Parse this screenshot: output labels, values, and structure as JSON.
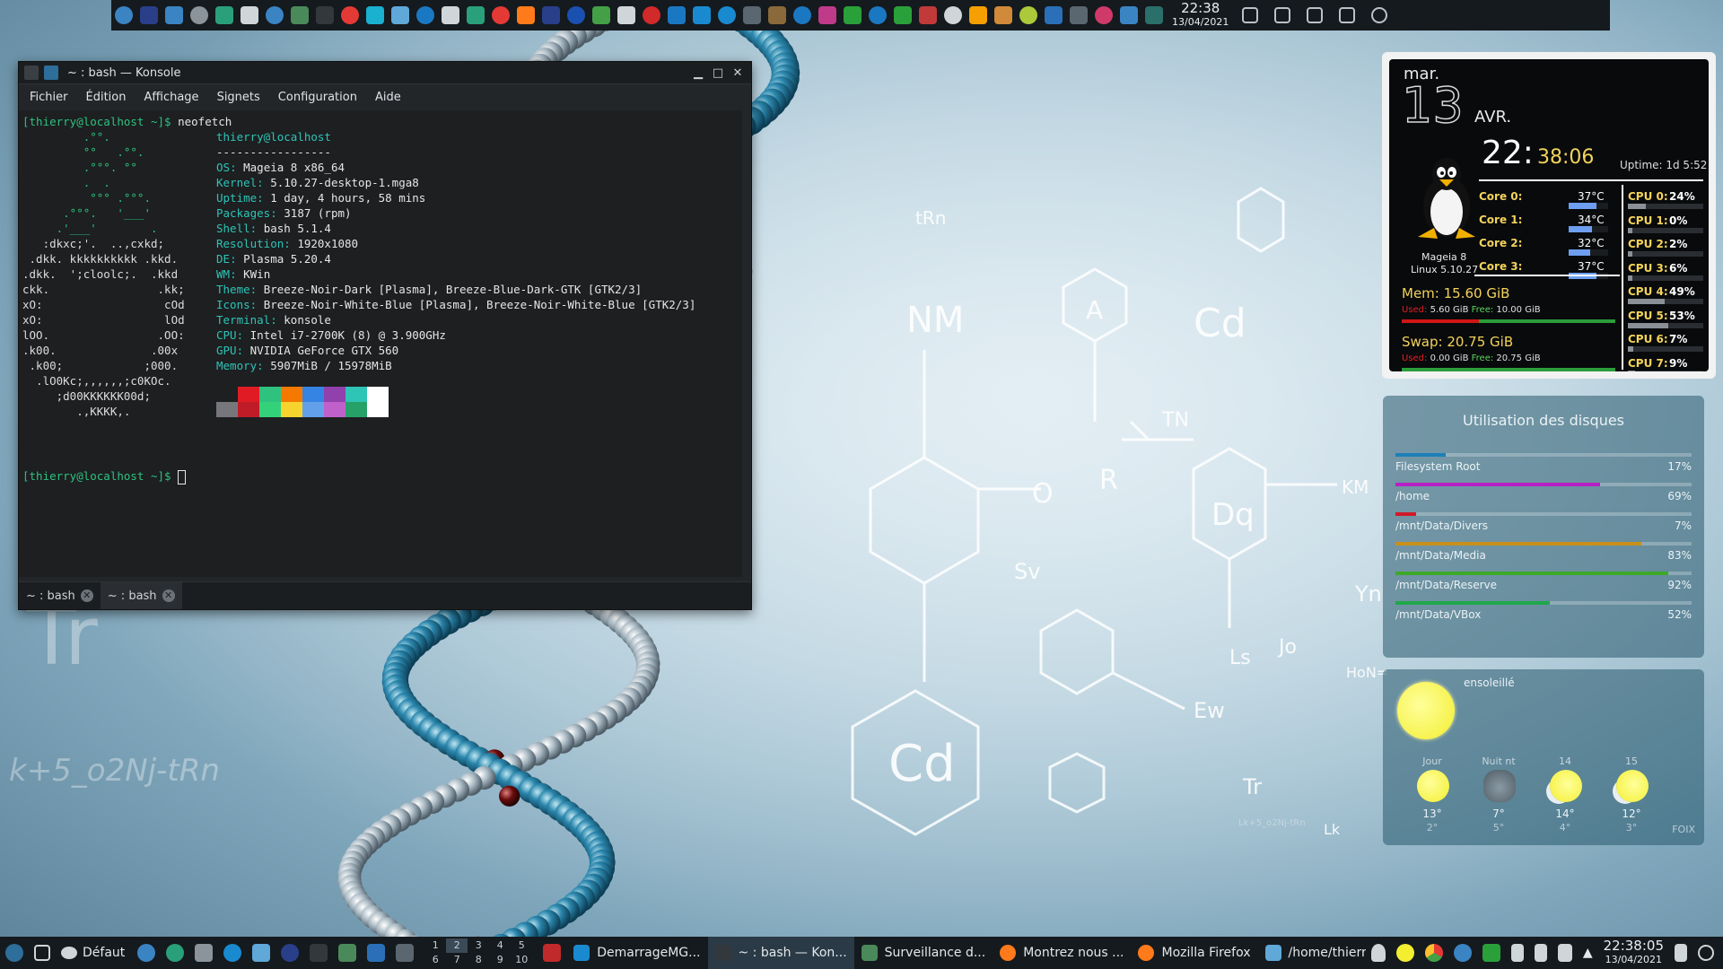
{
  "top_panel": {
    "clock_time": "22:38",
    "clock_date": "13/04/2021"
  },
  "konsole": {
    "title": "~ : bash — Konsole",
    "menu": [
      "Fichier",
      "Édition",
      "Affichage",
      "Signets",
      "Configuration",
      "Aide"
    ],
    "prompt1": "[thierry@localhost ~]$ ",
    "command": "neofetch",
    "prompt2": "[thierry@localhost ~]$ ",
    "user_host": "thierry@localhost",
    "separator": "-----------------",
    "ascii": [
      "         .°°.",
      "         °°   .°°.",
      "         .°°°. °°",
      "         .  .",
      "          °°° .°°°.",
      "      .°°°.   '___'",
      "     .'___'        .",
      "   :dkxc;'.  ..,cxkd;",
      " .dkk. kkkkkkkkkk .kkd.",
      ".dkk.  ';cloolc;.  .kkd",
      "ckk.                .kk;",
      "xO:                  cOd",
      "xO:                  lOd",
      "lOO.                .OO:",
      ".k00.              .00x",
      " .k00;            ;000.",
      "  .lO0Kc;,,,,,,;c0KOc.",
      "     ;d00KKKKKK00d;",
      "        .,KKKK,."
    ],
    "info": [
      {
        "key": "OS",
        "value": "Mageia 8 x86_64"
      },
      {
        "key": "Kernel",
        "value": "5.10.27-desktop-1.mga8"
      },
      {
        "key": "Uptime",
        "value": "1 day, 4 hours, 58 mins"
      },
      {
        "key": "Packages",
        "value": "3187 (rpm)"
      },
      {
        "key": "Shell",
        "value": "bash 5.1.4"
      },
      {
        "key": "Resolution",
        "value": "1920x1080"
      },
      {
        "key": "DE",
        "value": "Plasma 5.20.4"
      },
      {
        "key": "WM",
        "value": "KWin"
      },
      {
        "key": "Theme",
        "value": "Breeze-Noir-Dark [Plasma], Breeze-Blue-Dark-GTK [GTK2/3]"
      },
      {
        "key": "Icons",
        "value": "Breeze-Noir-White-Blue [Plasma], Breeze-Noir-White-Blue [GTK2/3]"
      },
      {
        "key": "Terminal",
        "value": "konsole"
      },
      {
        "key": "CPU",
        "value": "Intel i7-2700K (8) @ 3.900GHz"
      },
      {
        "key": "GPU",
        "value": "NVIDIA GeForce GTX 560"
      },
      {
        "key": "Memory",
        "value": "5907MiB / 15978MiB"
      }
    ],
    "palette_top": [
      "#1d1f21",
      "#e01b24",
      "#2ec27e",
      "#f57900",
      "#3584e4",
      "#9141ac",
      "#2ec4b6",
      "#ffffff"
    ],
    "palette_bottom": [
      "#77767b",
      "#c01c28",
      "#33d17a",
      "#f6d32d",
      "#62a0ea",
      "#c061cb",
      "#26a269",
      "#ffffff"
    ],
    "tabs": [
      "~ : bash",
      "~ : bash"
    ]
  },
  "sysmon": {
    "day": "mar.",
    "daynum": "13",
    "month": "AVR.",
    "hour": "22:",
    "minsec": "38:06",
    "uptime": "Uptime: 1d 5:52",
    "distro": "Mageia 8",
    "kernel": "Linux 5.10.27",
    "cores": [
      {
        "label": "Core 0:",
        "temp": "37°C",
        "level": 0.7
      },
      {
        "label": "Core 1:",
        "temp": "34°C",
        "level": 0.6
      },
      {
        "label": "Core 2:",
        "temp": "32°C",
        "level": 0.55
      },
      {
        "label": "Core 3:",
        "temp": "37°C",
        "level": 0.7
      }
    ],
    "cpus": [
      {
        "label": "CPU 0:",
        "value": "24%",
        "level": 0.24
      },
      {
        "label": "CPU 1:",
        "value": "0%",
        "level": 0.0
      },
      {
        "label": "CPU 2:",
        "value": "2%",
        "level": 0.02
      },
      {
        "label": "CPU 3:",
        "value": "6%",
        "level": 0.06
      },
      {
        "label": "CPU 4:",
        "value": "49%",
        "level": 0.49
      },
      {
        "label": "CPU 5:",
        "value": "53%",
        "level": 0.53
      },
      {
        "label": "CPU 6:",
        "value": "7%",
        "level": 0.07
      },
      {
        "label": "CPU 7:",
        "value": "9%",
        "level": 0.09
      }
    ],
    "mem_title": "Mem: 15.60 GiB",
    "mem_used_label": "Used:",
    "mem_used": "5.60 GiB",
    "mem_free_label": "Free:",
    "mem_free": "10.00 GiB",
    "mem_level": 0.36,
    "swap_title": "Swap: 20.75 GiB",
    "swap_used_label": "Used:",
    "swap_used": "0.00 GiB",
    "swap_free_label": "Free:",
    "swap_free": "20.75 GiB",
    "swap_level": 0.0
  },
  "disks": {
    "title": "Utilisation des disques",
    "items": [
      {
        "name": "Filesystem Root",
        "pct": "17%",
        "level": 0.17,
        "color": "#1e7fb8"
      },
      {
        "name": "/home",
        "pct": "69%",
        "level": 0.69,
        "color": "#b521c4"
      },
      {
        "name": "/mnt/Data/Divers",
        "pct": "7%",
        "level": 0.07,
        "color": "#d01a2a"
      },
      {
        "name": "/mnt/Data/Media",
        "pct": "83%",
        "level": 0.83,
        "color": "#c8901a"
      },
      {
        "name": "/mnt/Data/Reserve",
        "pct": "92%",
        "level": 0.92,
        "color": "#3da82a"
      },
      {
        "name": "/mnt/Data/VBox",
        "pct": "52%",
        "level": 0.52,
        "color": "#1fa84a"
      }
    ]
  },
  "weather": {
    "condition": "ensoleillé",
    "station": "FOIX",
    "forecast": [
      {
        "label": "Jour",
        "high": "13°",
        "low": "2°",
        "icon": "sun-icon"
      },
      {
        "label": "Nuit nt",
        "high": "7°",
        "low": "5°",
        "icon": "cloud-icon"
      },
      {
        "label": "14",
        "high": "14°",
        "low": "4°",
        "icon": "sun-cloud-icon"
      },
      {
        "label": "15",
        "high": "12°",
        "low": "3°",
        "icon": "sun-cloud-icon"
      }
    ]
  },
  "taskbar": {
    "activity": "Défaut",
    "pager": [
      "1",
      "2",
      "3",
      "4",
      "5",
      "6",
      "7",
      "8",
      "9",
      "10"
    ],
    "tasks": [
      {
        "label": "DemarrageMG...",
        "icon": "kde-connect-icon"
      },
      {
        "label": "~ : bash — Kon...",
        "icon": "terminal-icon"
      },
      {
        "label": "Surveillance d...",
        "icon": "system-monitor-icon"
      },
      {
        "label": "Montrez nous ...",
        "icon": "firefox-icon"
      },
      {
        "label": "Mozilla Firefox",
        "icon": "firefox-icon"
      },
      {
        "label": "/home/thierry/...",
        "icon": "folder-icon"
      }
    ],
    "clock_time": "22:38:05",
    "clock_date": "13/04/2021"
  }
}
